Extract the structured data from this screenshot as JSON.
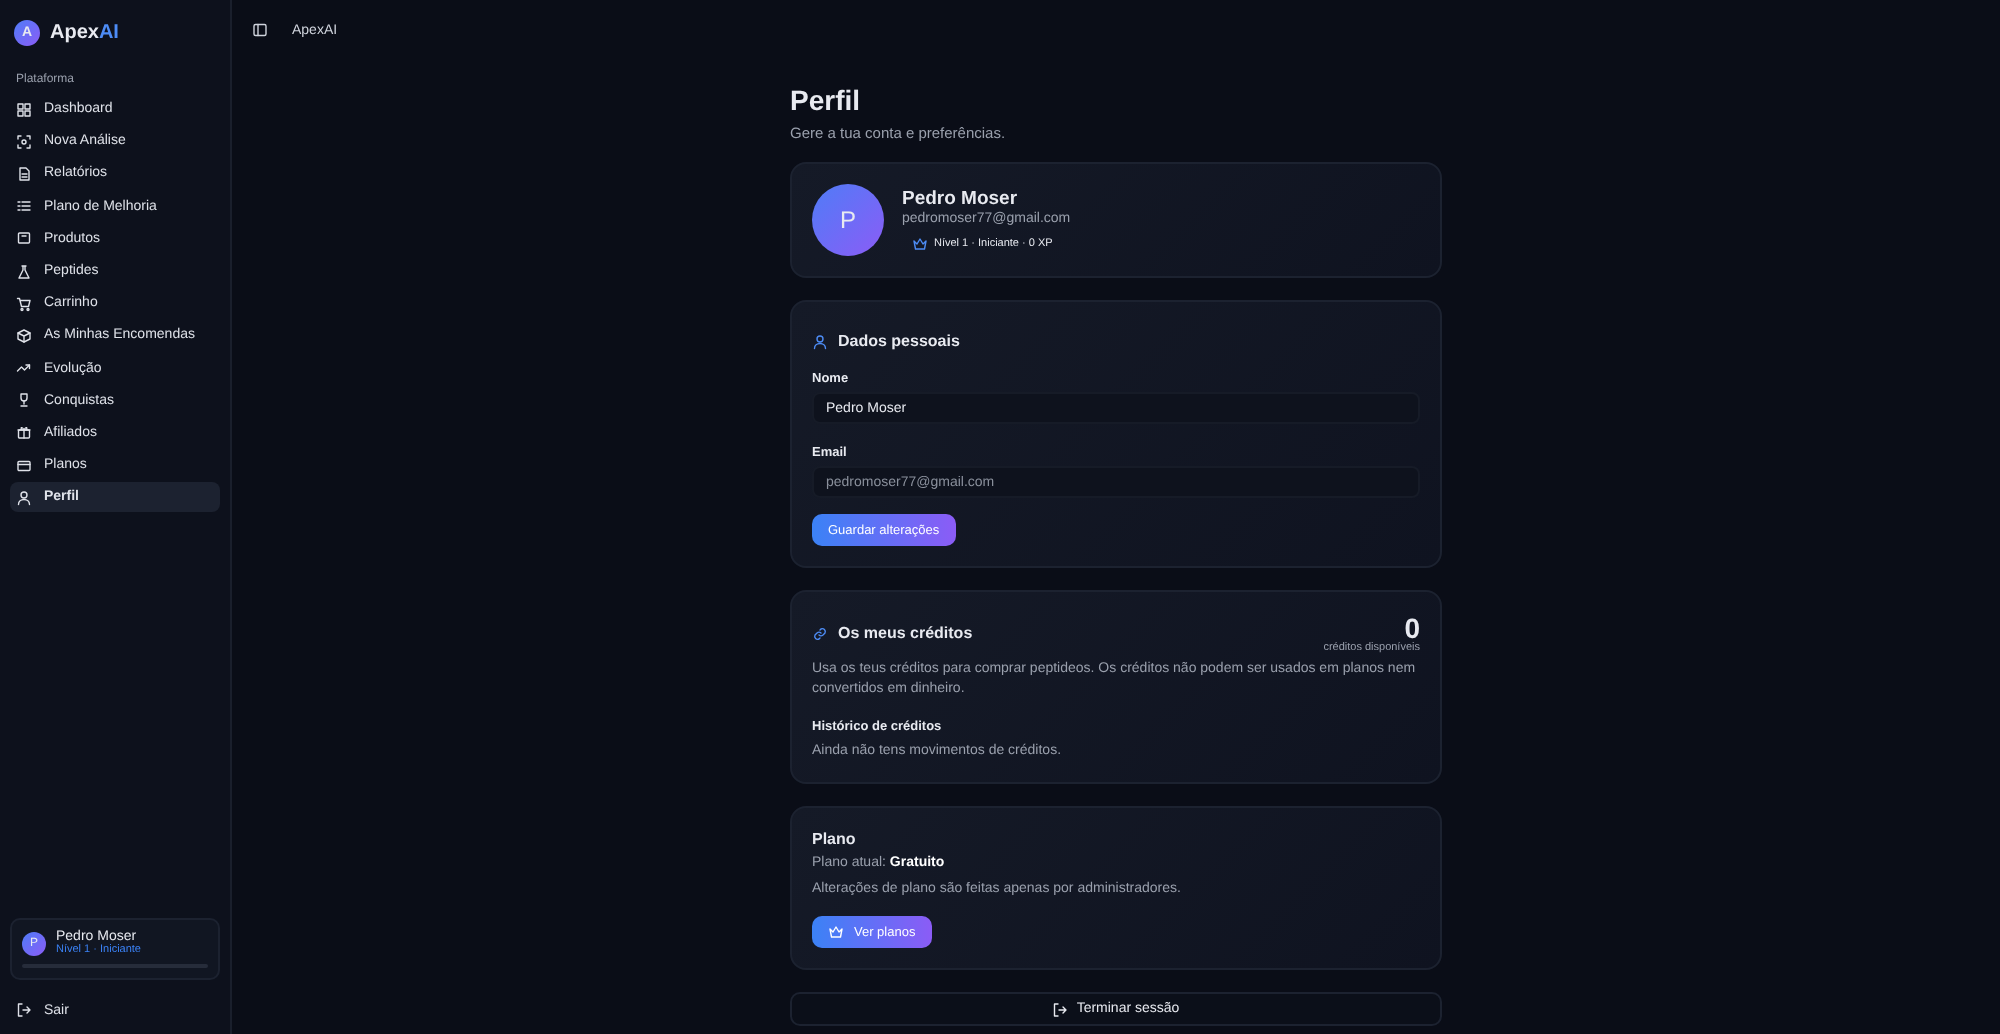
{
  "sidebar": {
    "logo_letter": "A",
    "brand": "Apex",
    "brand_accent": "AI",
    "section": "Plataforma",
    "items": [
      {
        "label": "Dashboard",
        "selected": false
      },
      {
        "label": "Nova Análise",
        "selected": false
      },
      {
        "label": "Relatórios",
        "selected": false
      },
      {
        "label": "Plano de Melhoria",
        "selected": false
      },
      {
        "label": "Produtos",
        "selected": false
      },
      {
        "label": "Peptides",
        "selected": false
      },
      {
        "label": "Carrinho",
        "selected": false
      },
      {
        "label": "As Minhas Encomendas",
        "selected": false
      },
      {
        "label": "Evolução",
        "selected": false
      },
      {
        "label": "Conquistas",
        "selected": false
      },
      {
        "label": "Afiliados",
        "selected": false
      },
      {
        "label": "Planos",
        "selected": false
      },
      {
        "label": "Perfil",
        "selected": true
      }
    ],
    "user": {
      "avatar": "P",
      "name": "Pedro Moser",
      "level_text": "Nível 1 · Iniciante",
      "level": 0
    },
    "logout": "Sair"
  },
  "topbar": {
    "breadcrumb": "ApexAI"
  },
  "page": {
    "title": "Perfil",
    "subtitle": "Gere a tua conta e preferências.",
    "profile": {
      "avatar": "P",
      "name": "Pedro Moser",
      "email": "pedromoser77@gmail.com",
      "badge": "Nível 1 · Iniciante · 0 XP"
    },
    "personal": {
      "title": "Dados pessoais",
      "fields": [
        {
          "label": "Nome",
          "value": "Pedro Moser",
          "disabled": false
        },
        {
          "label": "Email",
          "value": "pedromoser77@gmail.com",
          "disabled": true
        }
      ],
      "save": "Guardar alterações"
    },
    "credits": {
      "title": "Os meus créditos",
      "amount": "0",
      "amount_label": "créditos disponíveis",
      "description": "Usa os teus créditos para comprar peptideos. Os créditos não podem ser usados em planos nem convertidos em dinheiro.",
      "history_title": "Histórico de créditos",
      "history_empty": "Ainda não tens movimentos de créditos."
    },
    "plan": {
      "title": "Plano",
      "current": "Plano atual: **Gratuito**",
      "note": "Alterações de plano são feitas apenas por administradores.",
      "button": "Ver planos"
    },
    "end_session": "Terminar sessão"
  }
}
